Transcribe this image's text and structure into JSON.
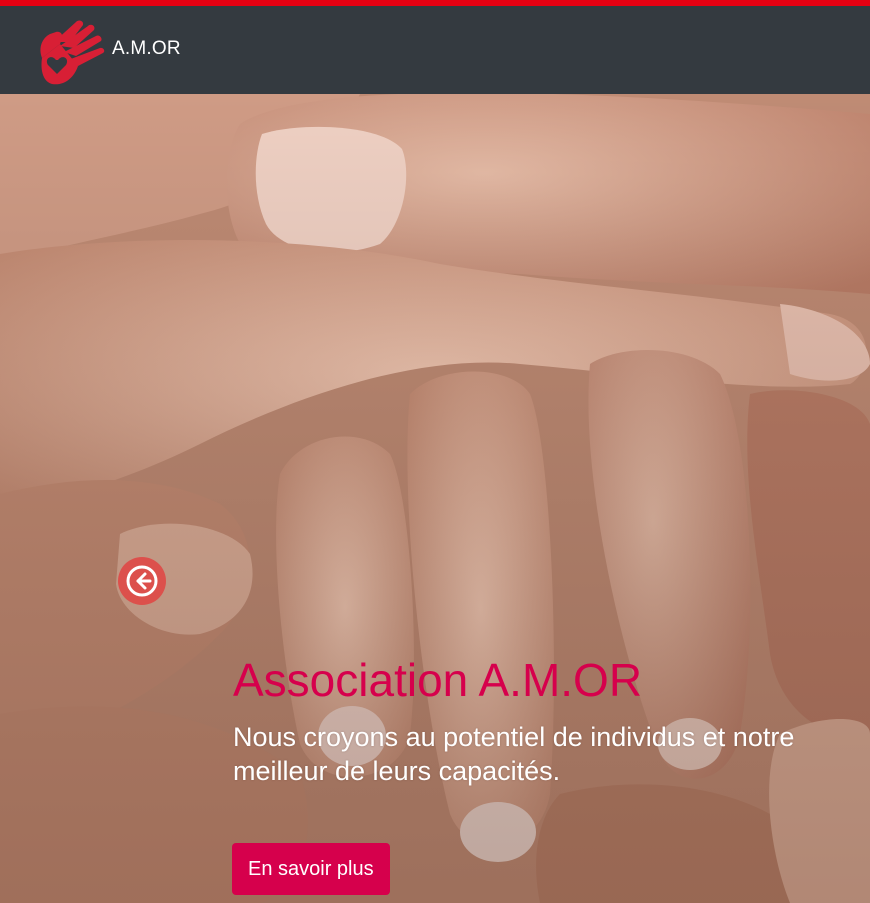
{
  "header": {
    "brand_name": "A.M.OR",
    "logo_icon": "heart-hand-icon",
    "accent_color": "#e60012",
    "background_color": "#343a40"
  },
  "hero": {
    "image_description_icon": "hands-stacked-photo",
    "prev_icon": "arrow-left-circle-icon",
    "title": "Association A.M.OR",
    "subtitle": "Nous croyons au potentiel de individus et notre meilleur de leurs capacités.",
    "cta_label": "En savoir plus",
    "title_color": "#d6004c",
    "cta_color": "#d6004c"
  }
}
